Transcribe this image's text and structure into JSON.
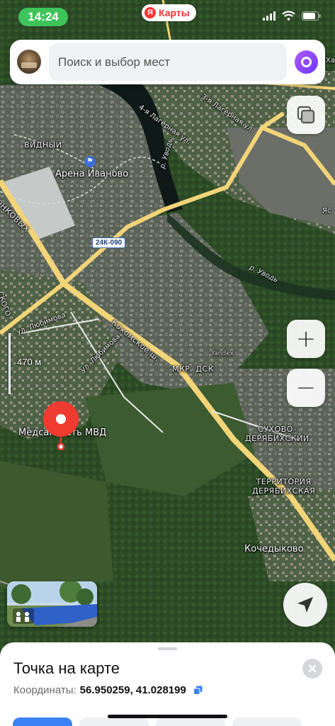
{
  "status_bar": {
    "time": "14:24",
    "app_badge": "Карты",
    "app_logo_letter": "Я"
  },
  "search": {
    "placeholder": "Поиск и выбор мест"
  },
  "map": {
    "places": {
      "arena": "Арена Иваново",
      "vidny": "ВИДНЫЙ",
      "medsanchast": "Медсанчасть МВД",
      "mkr_dsk": "МКР. ДСК",
      "sukhovo": "СУХОВО-\nДЕРЯБИХСКИЙ",
      "territoriya": "ТЕРРИТОРИЯ\nДЕРЯБИХСКАЯ",
      "kochedykovo": "Кочедыково",
      "yandex_bldg": "Yandex"
    },
    "streets": {
      "lageraya4": "4-я Лагерная ул.",
      "lageraya3": "3-я Лагерная ул.",
      "kokhomskoe": "Кохомское ш.",
      "lyubimova1": "ул. Любимова",
      "lyubimova2": "ул. Любимова",
      "onkovykh": "ОНКОВЫХ",
      "skogo": "СКОГО",
      "yas": "Яс",
      "kha": "Ха"
    },
    "water": {
      "uvod1": "р. Уводь",
      "uvod2": "р. Уводь"
    },
    "road_number": "24К-090",
    "scale": "470 м"
  },
  "controls": {
    "zoom_in": "+",
    "zoom_out": "−"
  },
  "sheet": {
    "title": "Точка на карте",
    "coords_label": "Координаты:",
    "coords_value": "56.950259, 41.028199"
  },
  "colors": {
    "accent": "#3b82f6",
    "status_green": "#3ec45a",
    "brand_red": "#ff3333",
    "pin_red": "#ef3a2f",
    "road_yellow": "#f2d479"
  }
}
